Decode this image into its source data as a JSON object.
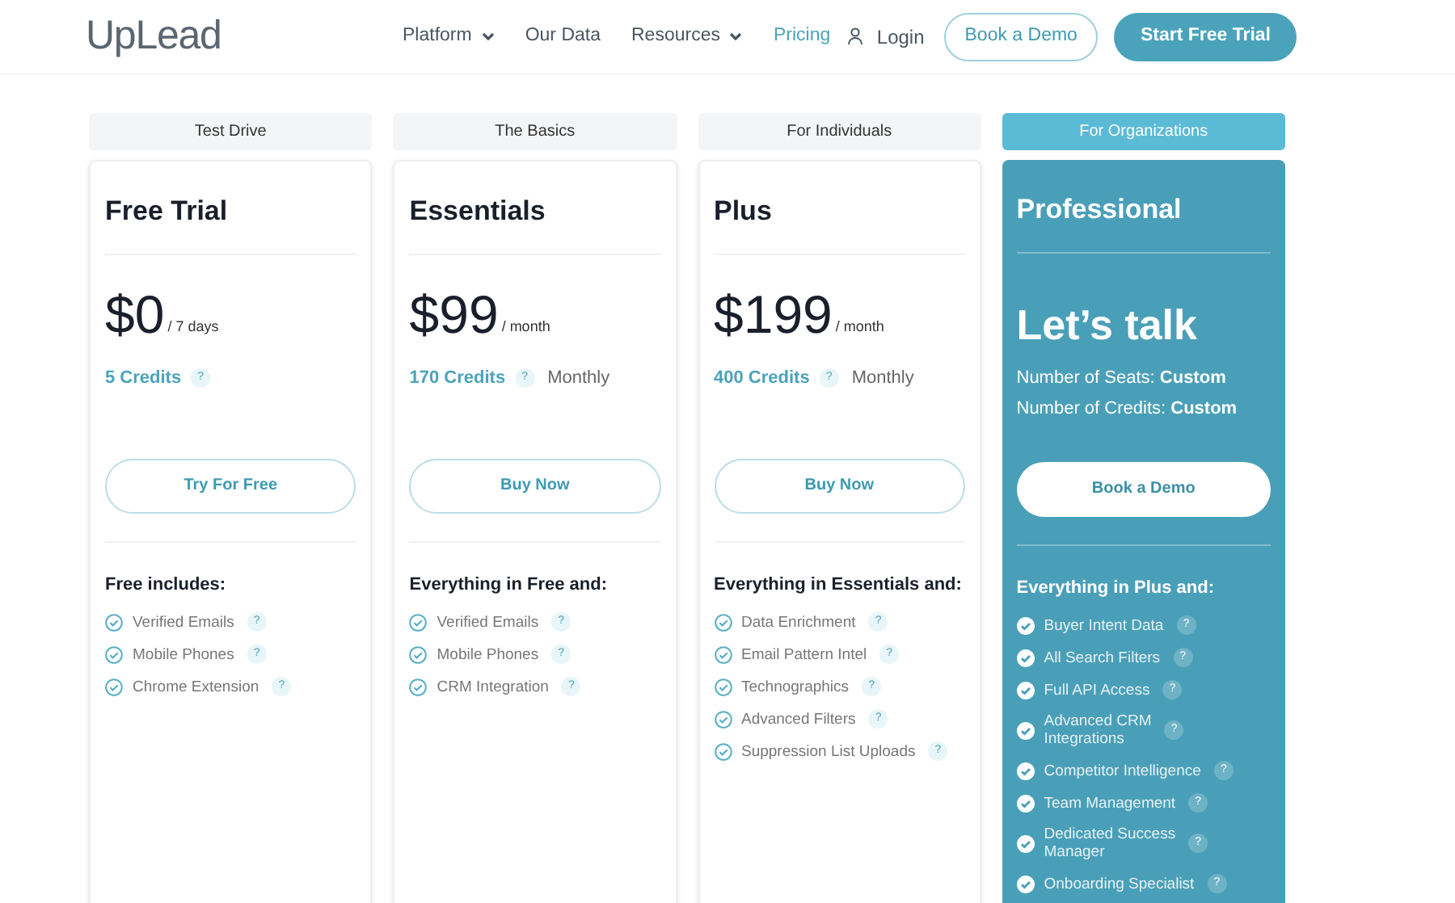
{
  "header": {
    "logo": "UpLead",
    "nav": [
      {
        "label": "Platform",
        "dropdown": true,
        "selected": false
      },
      {
        "label": "Our Data",
        "dropdown": false,
        "selected": false
      },
      {
        "label": "Resources",
        "dropdown": true,
        "selected": false
      },
      {
        "label": "Pricing",
        "dropdown": false,
        "selected": true
      }
    ],
    "login": "Login",
    "demo_button": "Book a Demo",
    "trial_button": "Start Free Trial"
  },
  "plans": [
    {
      "tier": "Test Drive",
      "featured": false,
      "name": "Free Trial",
      "kind": "price",
      "price": "$0",
      "period": "/ 7 days",
      "credits": "5 Credits",
      "credits_help": "?",
      "button": "Try For Free",
      "features_title": "Free includes:",
      "features": [
        {
          "text": "Verified Emails",
          "help": "?"
        },
        {
          "text": "Mobile Phones",
          "help": "?"
        },
        {
          "text": "Chrome Extension",
          "help": "?"
        }
      ]
    },
    {
      "tier": "The Basics",
      "featured": false,
      "name": "Essentials",
      "kind": "price",
      "price": "$99",
      "period": "/ month",
      "credits": "170 Credits",
      "credits_help": "?",
      "billing": "Monthly",
      "button": "Buy Now",
      "features_title": "Everything in Free and:",
      "features": [
        {
          "text": "Verified Emails",
          "help": "?"
        },
        {
          "text": "Mobile Phones",
          "help": "?"
        },
        {
          "text": "CRM Integration",
          "help": "?"
        }
      ]
    },
    {
      "tier": "For Individuals",
      "featured": false,
      "name": "Plus",
      "kind": "price",
      "price": "$199",
      "period": "/ month",
      "credits": "400 Credits",
      "credits_help": "?",
      "billing": "Monthly",
      "button": "Buy Now",
      "features_title": "Everything in Essentials and:",
      "features": [
        {
          "text": "Data Enrichment",
          "help": "?"
        },
        {
          "text": "Email Pattern Intel",
          "help": "?"
        },
        {
          "text": "Technographics",
          "help": "?"
        },
        {
          "text": "Advanced Filters",
          "help": "?"
        },
        {
          "text": "Suppression List Uploads",
          "help": "?"
        }
      ]
    },
    {
      "tier": "For Organizations",
      "featured": true,
      "name": "Professional",
      "kind": "talk",
      "headline": "Let’s talk",
      "info": [
        "Number of Seats: **Custom**",
        "Number of Credits: **Custom**"
      ],
      "button": "Book a Demo",
      "features_title": "Everything in Plus and:",
      "features": [
        {
          "text": "Buyer Intent Data",
          "help": "?"
        },
        {
          "text": "All Search Filters",
          "help": "?"
        },
        {
          "text": "Full API Access",
          "help": "?"
        },
        {
          "text": "Advanced CRM\nIntegrations",
          "help": "?"
        },
        {
          "text": "Competitor Intelligence",
          "help": "?"
        },
        {
          "text": "Team Management",
          "help": "?"
        },
        {
          "text": "Dedicated Success\nManager",
          "help": "?"
        },
        {
          "text": "Onboarding Specialist",
          "help": "?"
        }
      ]
    }
  ]
}
